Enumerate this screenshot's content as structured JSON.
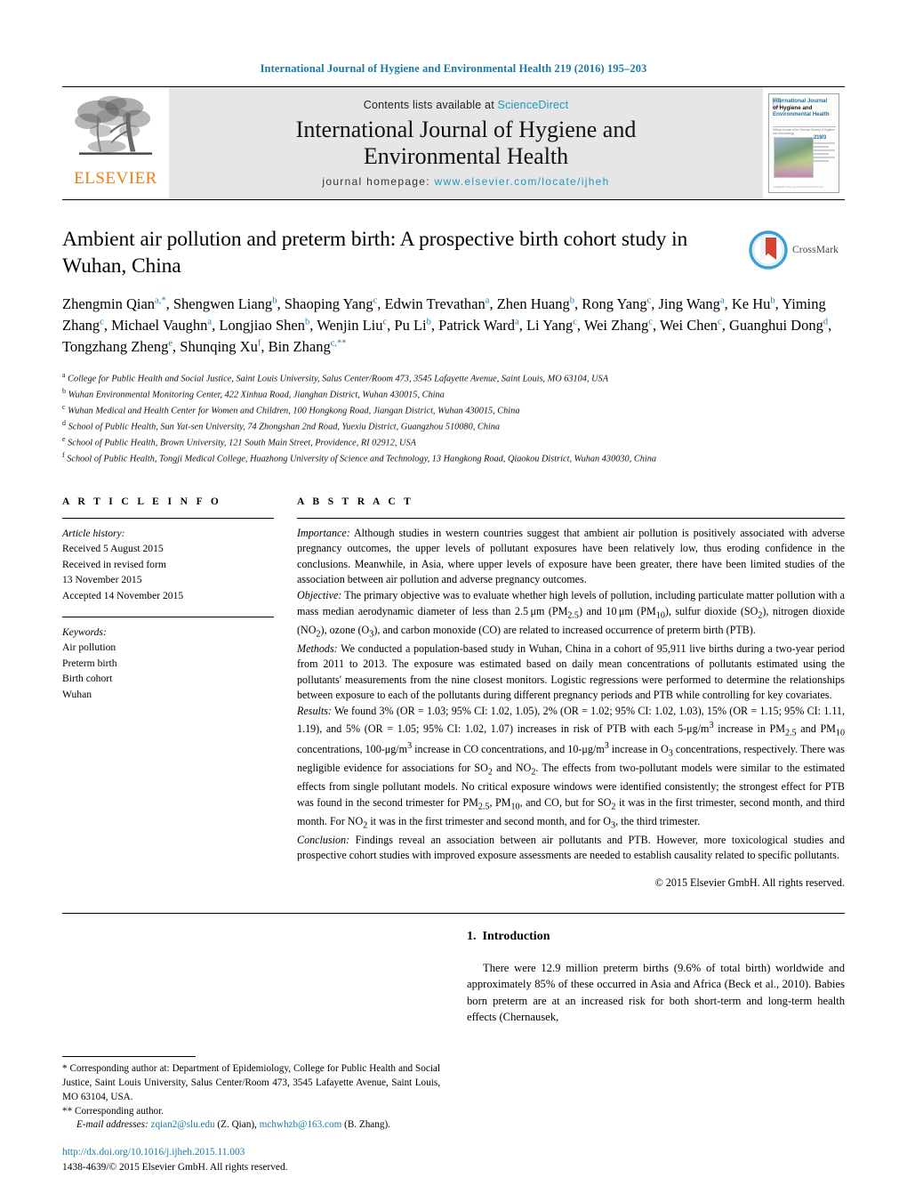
{
  "running_head": "International Journal of Hygiene and Environmental Health 219 (2016) 195–203",
  "masthead": {
    "publisher_name": "ELSEVIER",
    "contents_prefix": "Contents lists available at ",
    "contents_link": "ScienceDirect",
    "journal_title_line1": "International Journal of Hygiene and",
    "journal_title_line2": "Environmental Health",
    "homepage_prefix": "journal homepage: ",
    "homepage_url": "www.elsevier.com/locate/ijheh",
    "cover": {
      "title_line1": "International Journal",
      "title_line2": "of Hygiene and",
      "title_line3": "Environmental Health",
      "issue_label": "219/3",
      "sub_note": "Official Journal of the German Society of Hygiene and Microbiology",
      "footer": "Available online at www.sciencedirect.com"
    }
  },
  "crossmark": {
    "label": "CrossMark"
  },
  "article": {
    "title": "Ambient air pollution and preterm birth: A prospective birth cohort study in Wuhan, China",
    "authors_html": "Zhengmin Qian<sup>a,*</sup>, Shengwen Liang<sup>b</sup>, Shaoping Yang<sup>c</sup>, Edwin Trevathan<sup>a</sup>, Zhen Huang<sup>b</sup>, Rong Yang<sup>c</sup>, Jing Wang<sup>a</sup>, Ke Hu<sup>b</sup>, Yiming Zhang<sup>c</sup>, Michael Vaughn<sup>a</sup>, Longjiao Shen<sup>b</sup>, Wenjin Liu<sup>c</sup>, Pu Li<sup>b</sup>, Patrick Ward<sup>a</sup>, Li Yang<sup>c</sup>, Wei Zhang<sup>c</sup>, Wei Chen<sup>c</sup>, Guanghui Dong<sup>d</sup>, Tongzhang Zheng<sup>e</sup>, Shunqing Xu<sup>f</sup>, Bin Zhang<sup>c,**</sup>",
    "affiliations": [
      {
        "marker": "a",
        "text": "College for Public Health and Social Justice, Saint Louis University, Salus Center/Room 473, 3545 Lafayette Avenue, Saint Louis, MO 63104, USA"
      },
      {
        "marker": "b",
        "text": "Wuhan Environmental Monitoring Center, 422 Xinhua Road, Jianghan District, Wuhan 430015, China"
      },
      {
        "marker": "c",
        "text": "Wuhan Medical and Health Center for Women and Children, 100 Hongkong Road, Jiangan District, Wuhan 430015, China"
      },
      {
        "marker": "d",
        "text": "School of Public Health, Sun Yat-sen University, 74 Zhongshan 2nd Road, Yuexiu District, Guangzhou 510080, China"
      },
      {
        "marker": "e",
        "text": "School of Public Health, Brown University, 121 South Main Street, Providence, RI 02912, USA"
      },
      {
        "marker": "f",
        "text": "School of Public Health, Tongji Medical College, Huazhong University of Science and Technology, 13 Hangkong Road, Qiaokou District, Wuhan 430030, China"
      }
    ]
  },
  "article_info": {
    "heading": "A R T I C L E   I N F O",
    "history_label": "Article history:",
    "history_lines": [
      "Received 5 August 2015",
      "Received in revised form",
      "13 November 2015",
      "Accepted 14 November 2015"
    ],
    "keywords_label": "Keywords:",
    "keywords": [
      "Air pollution",
      "Preterm birth",
      "Birth cohort",
      "Wuhan"
    ]
  },
  "abstract": {
    "heading": "A B S T R A C T",
    "importance_label": "Importance:",
    "importance_text": " Although studies in western countries suggest that ambient air pollution is positively associated with adverse pregnancy outcomes, the upper levels of pollutant exposures have been relatively low, thus eroding confidence in the conclusions. Meanwhile, in Asia, where upper levels of exposure have been greater, there have been limited studies of the association between air pollution and adverse pregnancy outcomes.",
    "objective_label": "Objective:",
    "objective_html": " The primary objective was to evaluate whether high levels of pollution, including particulate matter pollution with a mass median aerodynamic diameter of less than 2.5&thinsp;&mu;m (PM<sub>2.5</sub>) and 10&thinsp;&mu;m (PM<sub>10</sub>), sulfur dioxide (SO<sub>2</sub>), nitrogen dioxide (NO<sub>2</sub>), ozone (O<sub>3</sub>), and carbon monoxide (CO) are related to increased occurrence of preterm birth (PTB).",
    "methods_label": "Methods:",
    "methods_text": " We conducted a population-based study in Wuhan, China in a cohort of 95,911 live births during a two-year period from 2011 to 2013. The exposure was estimated based on daily mean concentrations of pollutants estimated using the pollutants' measurements from the nine closest monitors. Logistic regressions were performed to determine the relationships between exposure to each of the pollutants during different pregnancy periods and PTB while controlling for key covariates.",
    "results_label": "Results:",
    "results_html": " We found 3% (OR = 1.03; 95% CI: 1.02, 1.05), 2% (OR = 1.02; 95% CI: 1.02, 1.03), 15% (OR = 1.15; 95% CI: 1.11, 1.19), and 5% (OR = 1.05; 95% CI: 1.02, 1.07) increases in risk of PTB with each 5-&mu;g/m<sup>3</sup> increase in PM<sub>2.5</sub> and PM<sub>10</sub> concentrations, 100-&mu;g/m<sup>3</sup> increase in CO concentrations, and 10-&mu;g/m<sup>3</sup> increase in O<sub>3</sub> concentrations, respectively. There was negligible evidence for associations for SO<sub>2</sub> and NO<sub>2</sub>. The effects from two-pollutant models were similar to the estimated effects from single pollutant models. No critical exposure windows were identified consistently; the strongest effect for PTB was found in the second trimester for PM<sub>2.5</sub>, PM<sub>10</sub>, and CO, but for SO<sub>2</sub> it was in the first trimester, second month, and third month. For NO<sub>2</sub> it was in the first trimester and second month, and for O<sub>3</sub>, the third trimester.",
    "conclusion_label": "Conclusion:",
    "conclusion_text": " Findings reveal an association between air pollutants and PTB. However, more toxicological studies and prospective cohort studies with improved exposure assessments are needed to establish causality related to specific pollutants.",
    "copyright": "© 2015 Elsevier GmbH. All rights reserved."
  },
  "introduction": {
    "number": "1.",
    "heading": "Introduction",
    "paragraph_pre": "There were 12.9 million preterm births (9.6% of total birth) worldwide and approximately 85% of these occurred in Asia and Africa (",
    "citation1": "Beck et al., 2010",
    "paragraph_mid": "). Babies born preterm are at an increased risk for both short-term and long-term health effects (",
    "citation2": "Chernausek,"
  },
  "footnotes": {
    "star_marker": "*",
    "star_text": " Corresponding author at: Department of Epidemiology, College for Public Health and Social Justice, Saint Louis University, Salus Center/Room 473, 3545 Lafayette Avenue, Saint Louis, MO 63104, USA.",
    "dstar_marker": "**",
    "dstar_text": " Corresponding author.",
    "email_label": "E-mail addresses:",
    "email1": "zqian2@slu.edu",
    "email1_owner": " (Z. Qian), ",
    "email2": "mchwhzb@163.com",
    "email2_owner": " (B. Zhang).",
    "doi": "http://dx.doi.org/10.1016/j.ijheh.2015.11.003",
    "issn_line": "1438-4639/© 2015 Elsevier GmbH. All rights reserved."
  }
}
